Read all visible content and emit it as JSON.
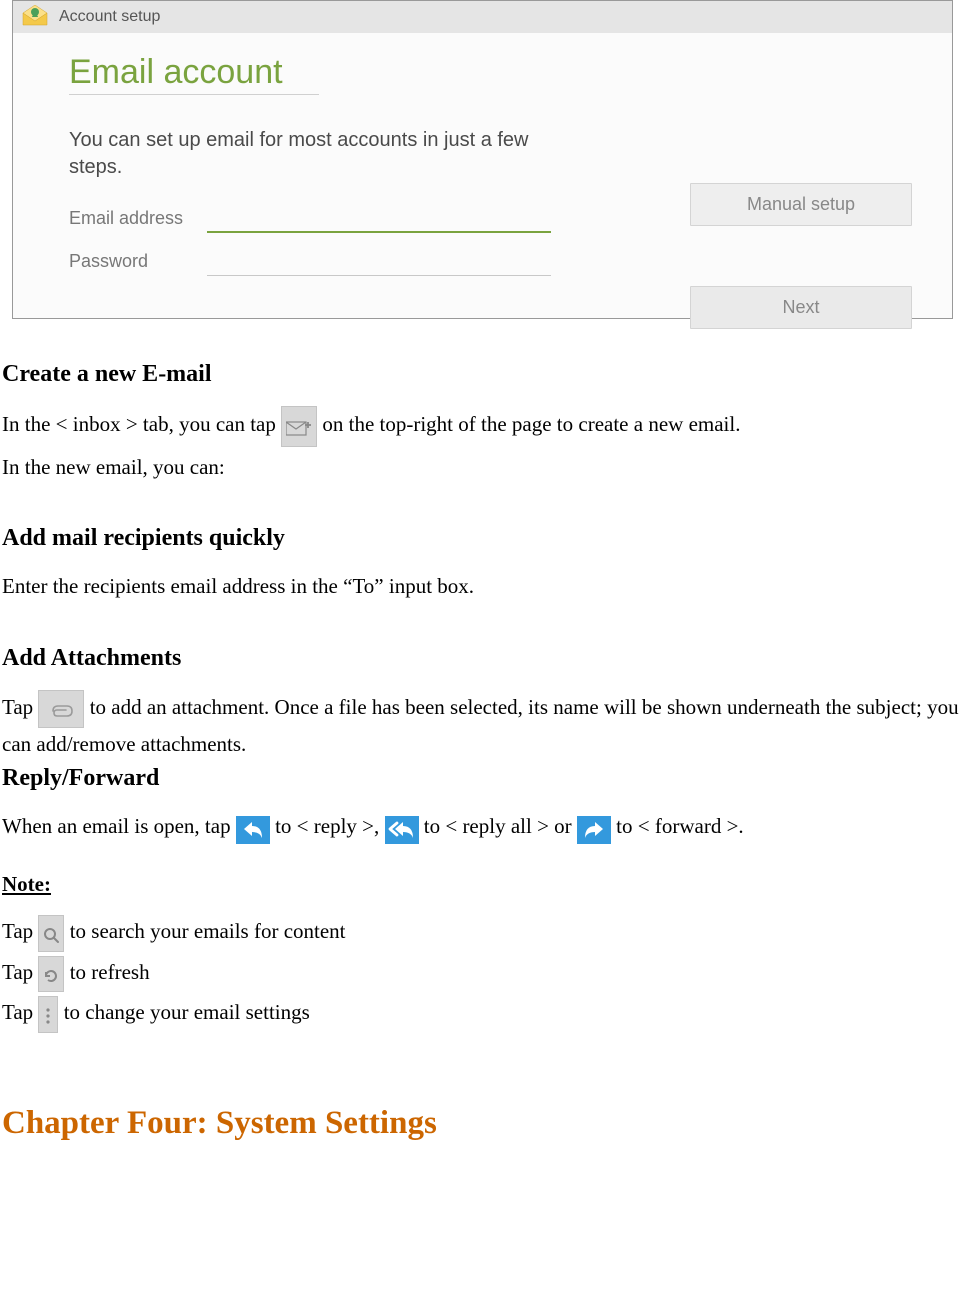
{
  "screenshot": {
    "headerTitle": "Account setup",
    "panelTitle": "Email account",
    "subtitle": "You can set up email for most accounts in just a few steps.",
    "emailLabel": "Email address",
    "passwordLabel": "Password",
    "manualBtn": "Manual setup",
    "nextBtn": "Next"
  },
  "sections": {
    "createTitle": "Create a new E-mail",
    "createP1a": "In the < inbox > tab, you can tap ",
    "createP1b": " on the top-right of the page to create a new email.",
    "createP2": "In the new email, you can:",
    "recipTitle": "Add mail recipients quickly",
    "recipP": "Enter the recipients email address in the “To” input box.",
    "attachTitle": "Add Attachments",
    "attachPa": "Tap ",
    "attachPb": " to add an attachment. Once a file has been selected, its name will be shown underneath the subject; you can add/remove attachments.",
    "replyTitle": "Reply/Forward",
    "replyA": "When an email is open, tap ",
    "replyB": " to < reply >, ",
    "replyC": " to < reply all > or ",
    "replyD": " to < forward >.",
    "noteTitle": "Note:",
    "note1a": "Tap ",
    "note1b": " to search your emails for content",
    "note2a": "Tap ",
    "note2b": " to refresh",
    "note3a": "Tap ",
    "note3b": " to change your email settings",
    "chapterTitle": "Chapter Four: System Settings"
  }
}
